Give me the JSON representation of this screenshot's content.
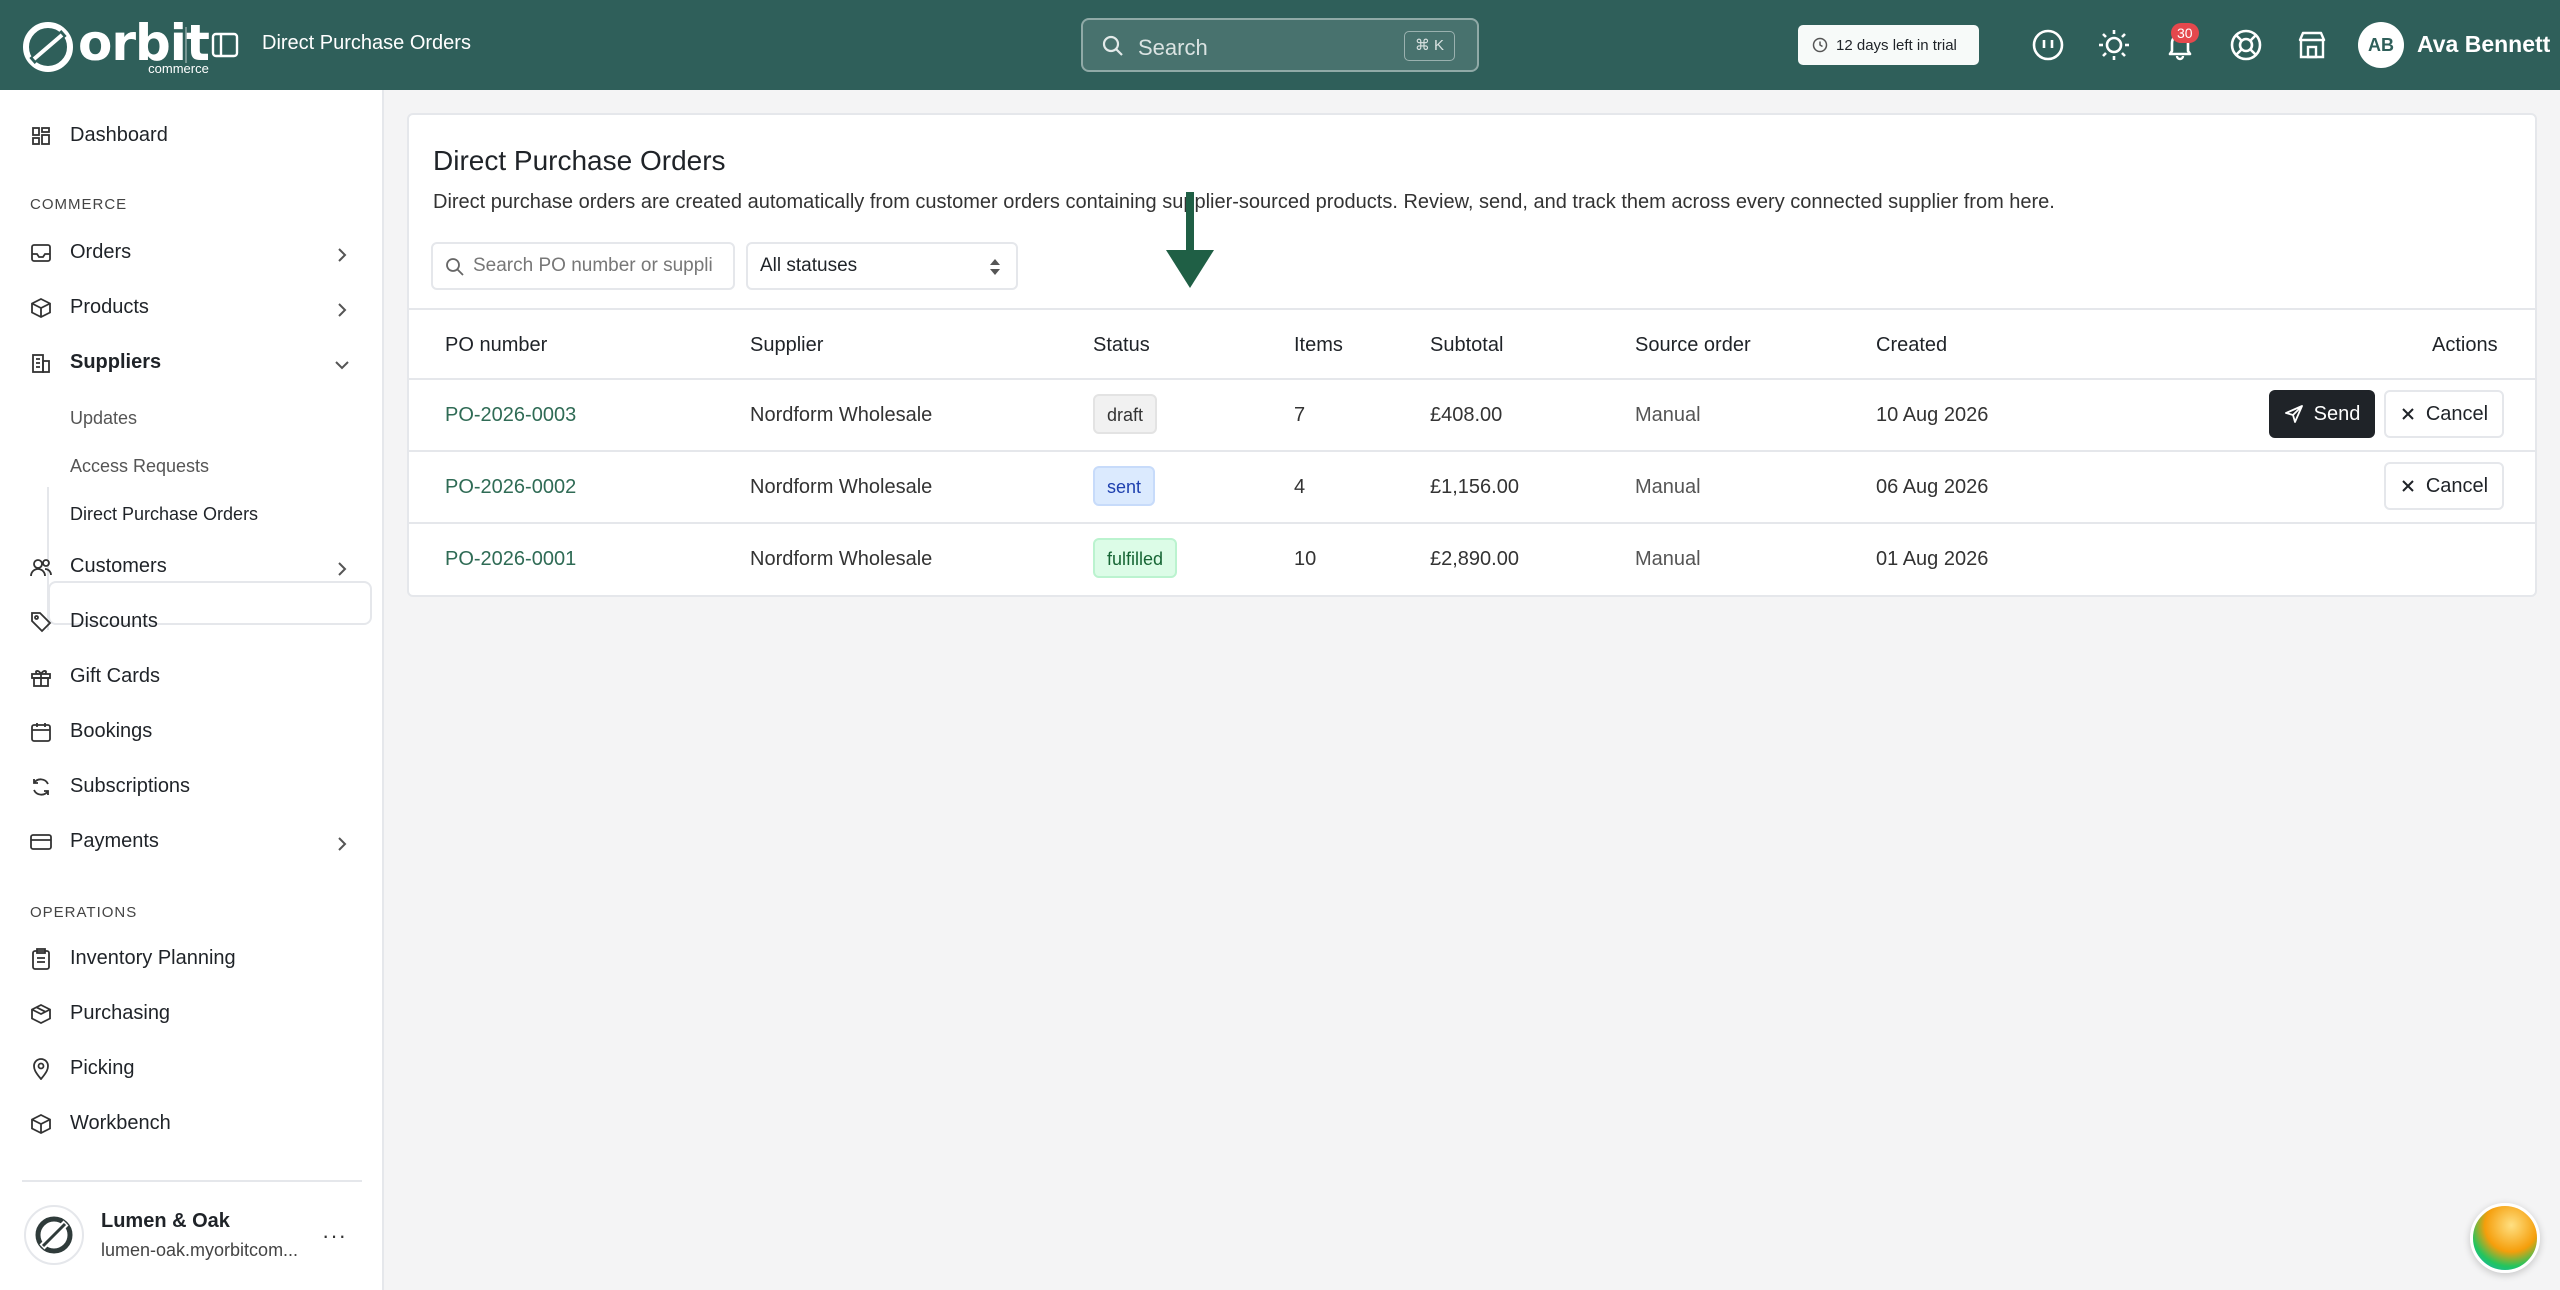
{
  "app": {
    "logo_word": "orbit",
    "logo_sub": "commerce",
    "page_title": "Direct Purchase Orders",
    "search_placeholder": "Search",
    "search_shortcut": "⌘ K",
    "trial_text": "12 days left in trial",
    "notification_count": "30",
    "user_initials": "AB",
    "user_name": "Ava Bennett",
    "colors": {
      "header": "#2f5f5a",
      "link": "#2f6b55",
      "badge_red": "#e5484d"
    }
  },
  "sidebar": {
    "dashboard": "Dashboard",
    "commerce_label": "COMMERCE",
    "orders": "Orders",
    "products": "Products",
    "suppliers": "Suppliers",
    "supplier_sub": [
      "Updates",
      "Access Requests",
      "Direct Purchase Orders"
    ],
    "customers": "Customers",
    "discounts": "Discounts",
    "gift_cards": "Gift Cards",
    "bookings": "Bookings",
    "subscriptions": "Subscriptions",
    "payments": "Payments",
    "operations_label": "OPERATIONS",
    "inventory_planning": "Inventory Planning",
    "purchasing": "Purchasing",
    "picking": "Picking",
    "workbench": "Workbench",
    "store_name": "Lumen & Oak",
    "store_domain": "lumen-oak.myorbitcom...",
    "more": "···"
  },
  "main": {
    "title": "Direct Purchase Orders",
    "description": "Direct purchase orders are created automatically from customer orders containing supplier-sourced products. Review, send, and track them across every connected supplier from here.",
    "search_placeholder": "Search PO number or suppli",
    "status_filter": "All statuses",
    "columns": [
      "PO number",
      "Supplier",
      "Status",
      "Items",
      "Subtotal",
      "Source order",
      "Created",
      "Actions"
    ],
    "rows": [
      {
        "po": "PO-2026-0003",
        "supplier": "Nordform Wholesale",
        "status": "draft",
        "items": "7",
        "subtotal": "£408.00",
        "source": "Manual",
        "created": "10 Aug 2026"
      },
      {
        "po": "PO-2026-0002",
        "supplier": "Nordform Wholesale",
        "status": "sent",
        "items": "4",
        "subtotal": "£1,156.00",
        "source": "Manual",
        "created": "06 Aug 2026"
      },
      {
        "po": "PO-2026-0001",
        "supplier": "Nordform Wholesale",
        "status": "fulfilled",
        "items": "10",
        "subtotal": "£2,890.00",
        "source": "Manual",
        "created": "01 Aug 2026"
      }
    ],
    "send_label": "Send",
    "cancel_label": "Cancel"
  }
}
